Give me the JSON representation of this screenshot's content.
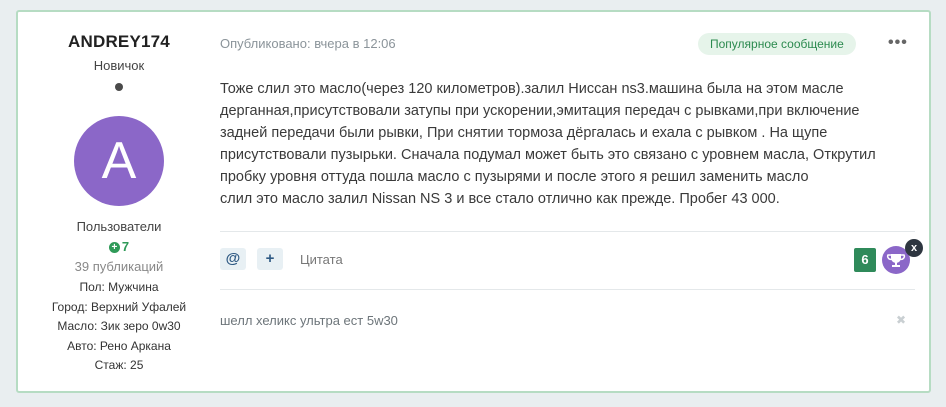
{
  "author": {
    "name": "ANDREY174",
    "rank": "Новичок",
    "avatar_letter": "A",
    "avatar_color": "#8b67c8",
    "group": "Пользователи",
    "reputation": "7",
    "posts": "39 публикаций",
    "fields": [
      "Пол: Мужчина",
      "Город: Верхний Уфалей",
      "Масло: Зик зеро 0w30",
      "Авто: Рено Аркана",
      "Стаж: 25"
    ]
  },
  "post": {
    "meta": "Опубликовано: вчера в 12:06",
    "badge": "Популярное сообщение",
    "more_label": "•••",
    "lines": [
      "Тоже слил это масло(через 120 километров).залил Ниссан ns3.машина была на этом масле",
      "дерганная,присутствовали затупы при ускорении,эмитация передач с рывками,при включение",
      "задней передачи были рывки, При снятии тормоза дёргалась  и ехала с рывком . На щупе",
      "присутствовали пузырьки. Сначала подумал может быть это связано с уровнем масла, Открутил",
      "пробку уровня оттуда пошла масло с пузырями и после этого я решил заменить масло",
      "слил это масло залил Nissan NS 3 и все стало отлично как прежде. Пробег 43 000."
    ],
    "actions": {
      "mention": "@",
      "plus": "+",
      "quote": "Цитата"
    },
    "reaction_count": "6",
    "close_label": "x",
    "signature": "шелл хеликс ультра ест 5w30",
    "signature_close": "✖"
  }
}
